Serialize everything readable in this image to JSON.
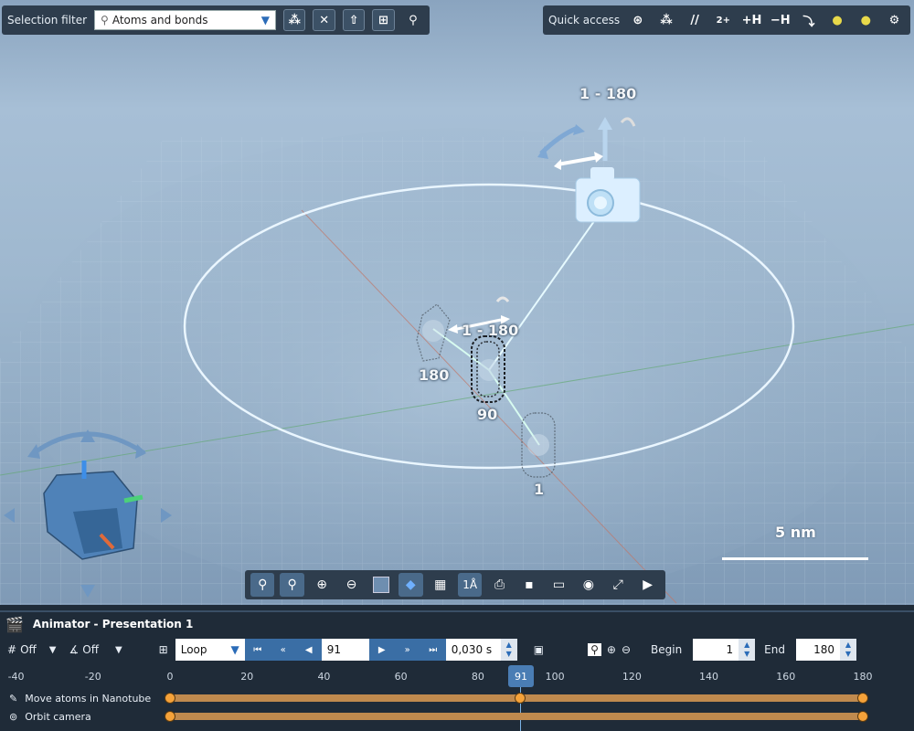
{
  "top_toolbar": {
    "selection_filter_label": "Selection filter",
    "selection_filter_value": "Atoms and bonds",
    "quick_access_label": "Quick access",
    "qa_plus_h": "+H",
    "qa_minus_h": "−H",
    "qa_charge": "2+"
  },
  "scene": {
    "camera_range": "1 - 180",
    "tube_range": "1 - 180",
    "label_180": "180",
    "label_90": "90",
    "label_1": "1",
    "scale_label": "5 nm"
  },
  "animator": {
    "title": "Animator - Presentation 1",
    "grid_toggle": "Off",
    "magnet_toggle": "Off",
    "loop_mode": "Loop",
    "current_frame": "91",
    "frame_time": "0,030 s",
    "begin_label": "Begin",
    "begin_value": "1",
    "end_label": "End",
    "end_value": "180",
    "playhead": "91",
    "ruler": [
      "-40",
      "-20",
      "0",
      "20",
      "40",
      "60",
      "80",
      "100",
      "120",
      "140",
      "160",
      "180"
    ],
    "tracks": [
      {
        "name": "Move atoms in Nanotube",
        "keyframes": [
          0,
          91,
          180
        ]
      },
      {
        "name": "Orbit camera",
        "keyframes": [
          0,
          180
        ]
      }
    ]
  },
  "colors": {
    "keyframe": "#f5a23a",
    "track_bar": "#c08a4e",
    "panel_bg": "#1f2b38",
    "accent": "#3a6ea5"
  }
}
